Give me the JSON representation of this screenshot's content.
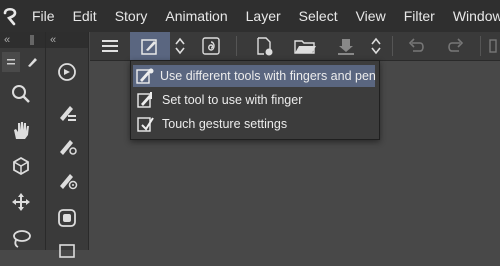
{
  "menubar": {
    "items": [
      "File",
      "Edit",
      "Story",
      "Animation",
      "Layer",
      "Select",
      "View",
      "Filter",
      "Window"
    ]
  },
  "popup": {
    "items": [
      {
        "label": "Use different tools with fingers and pen",
        "icon": "pen-finger-icon",
        "selected": true
      },
      {
        "label": "Set tool to use with finger",
        "icon": "finger-tool-icon",
        "selected": false
      },
      {
        "label": "Touch gesture settings",
        "icon": "touch-gesture-icon",
        "selected": false
      }
    ]
  },
  "colors": {
    "menubar_bg": "#2f2f2f",
    "toolbar_bg": "#3a3a3a",
    "canvas_bg": "#484848",
    "selection": "#5a6680"
  }
}
